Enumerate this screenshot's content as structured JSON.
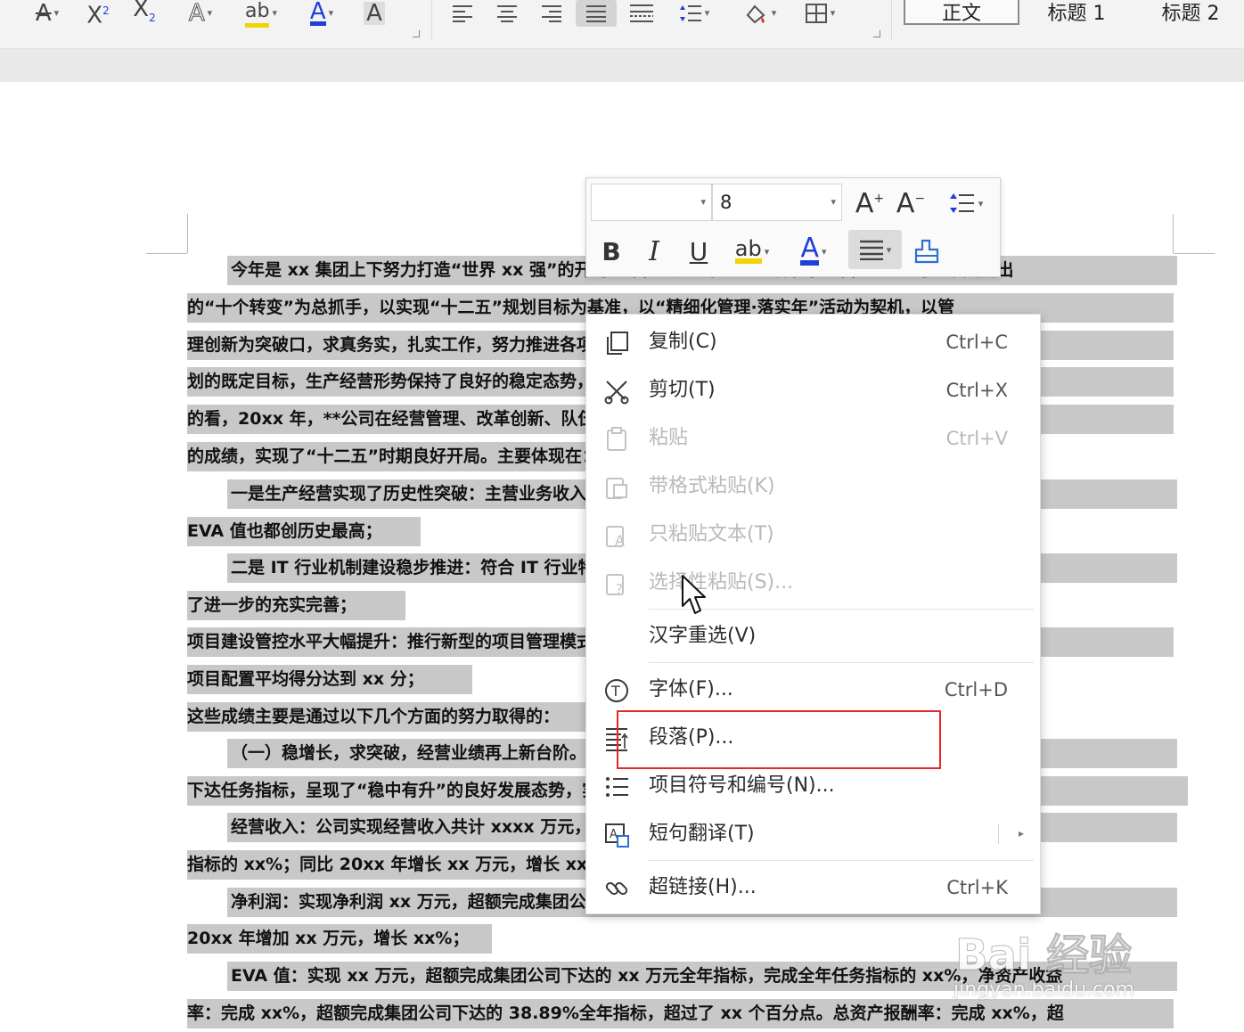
{
  "ribbon": {
    "font_tools": [
      {
        "icon": "strikethrough-icon",
        "glyph": "A"
      },
      {
        "icon": "superscript-icon",
        "glyph": "X²"
      },
      {
        "icon": "subscript-icon",
        "glyph": "X₂"
      },
      {
        "icon": "text-effect-icon",
        "glyph": "A"
      },
      {
        "icon": "highlight-color-icon",
        "glyph": "ab"
      },
      {
        "icon": "font-color-icon",
        "glyph": "A"
      },
      {
        "icon": "character-shading-icon",
        "glyph": "A"
      }
    ],
    "paragraph_tools": [
      "align-left-icon",
      "align-center-icon",
      "align-right-icon",
      "justify-icon",
      "distributed-icon",
      "line-spacing-icon",
      "shading-icon",
      "borders-icon"
    ],
    "styles": [
      "正文",
      "标题 1",
      "标题 2"
    ]
  },
  "document": {
    "lines": [
      "今年是 xx 集团上下努力打造“世界 xx 强”的开局之年，也是“十二五”的开局之年，xx 公司以集团提出",
      "的“十个转变”为总抓手，以实现“十二五”规划目标为基准，以“精细化管理·落实年”活动为契机，以管",
      "理创新为突破口，求真务实，扎实工作，努力推进各项工作，确保完成年度任务，向“十二五”规",
      "划的既定目标，生产经营形势保持了良好的稳定态势，企业呈现出持续、健康、快速的发展态势。总",
      "的看，20xx 年，**公司在经营管理、改革创新、队伍建设和企业文化等各个方面都取得了新",
      "的成绩，实现了“十二五”时期良好开局。主要体现在：",
      "一是生产经营实现了历史性突破：主营业务收入、利润总额、经济增加值、人均产值、",
      "EVA 值也都创历史最高；",
      "二是 IT 行业机制建设稳步推进：符合 IT 行业特点的管理体系逐步建立，各项新的举措，得到",
      "了进一步的充实完善；",
      "项目建设管控水平大幅提升：推行新型的项目管理模式，项目按期完成率均达到 xx%，",
      "项目配置平均得分达到 xx 分；",
      "这些成绩主要是通过以下几个方面的努力取得的：",
      "（一）稳增长，求突破，经营业绩再上新台阶。全年各项经营指标均超额完成了集团",
      "下达任务指标，呈现了“稳中有升”的良好发展态势，实现了历史性突破。",
      "经营收入：公司实现经营收入共计 xxxx 万元，超额完成集团下达的全年指标，完成全年任务",
      "指标的 xx%；同比 20xx 年增长 xx 万元，增长 xx%；",
      "净利润：实现净利润 xx 万元，超额完成集团公司下达的全年任务指标，完成计划的 xx%，同比",
      "20xx 年增加 xx 万元，增长 xx%；",
      "EVA 值：实现 xx 万元，超额完成集团公司下达的 xx 万元全年指标，完成全年任务指标的 xx%，净资产收益",
      "率：完成 xx%，超额完成集团公司下达的 38.89%全年指标，超过了 xx 个百分点。总资产报酬率：完成 xx%，超"
    ]
  },
  "mini_toolbar": {
    "font_name": "",
    "font_size": "8"
  },
  "context_menu": {
    "items": [
      {
        "label": "复制(C)",
        "shortcut": "Ctrl+C",
        "icon": "copy-icon",
        "disabled": false
      },
      {
        "label": "剪切(T)",
        "shortcut": "Ctrl+X",
        "icon": "scissors-icon",
        "disabled": false
      },
      {
        "label": "粘贴",
        "shortcut": "Ctrl+V",
        "icon": "paste-icon",
        "disabled": true
      },
      {
        "label": "带格式粘贴(K)",
        "shortcut": "",
        "icon": "paste-formatted-icon",
        "disabled": true
      },
      {
        "label": "只粘贴文本(T)",
        "shortcut": "",
        "icon": "paste-text-icon",
        "disabled": true
      },
      {
        "label": "选择性粘贴(S)...",
        "shortcut": "",
        "icon": "paste-special-icon",
        "disabled": true
      },
      {
        "label": "汉字重选(V)",
        "shortcut": "",
        "icon": "",
        "disabled": false
      },
      {
        "label": "字体(F)...",
        "shortcut": "Ctrl+D",
        "icon": "font-icon",
        "disabled": false
      },
      {
        "label": "段落(P)...",
        "shortcut": "",
        "icon": "paragraph-icon",
        "disabled": false
      },
      {
        "label": "项目符号和编号(N)...",
        "shortcut": "",
        "icon": "bullets-icon",
        "disabled": false
      },
      {
        "label": "短句翻译(T)",
        "shortcut": "",
        "icon": "translate-icon",
        "disabled": false
      },
      {
        "label": "超链接(H)...",
        "shortcut": "Ctrl+K",
        "icon": "link-icon",
        "disabled": false
      }
    ]
  },
  "watermark": {
    "logo": "Bai 经验",
    "url": "jingyan.baidu.com"
  },
  "colors": {
    "selection": "#c8c8c8",
    "highlight_box": "#e8262a",
    "font_color_accent": "#1f3fd6",
    "highlight_accent": "#f1d400"
  }
}
